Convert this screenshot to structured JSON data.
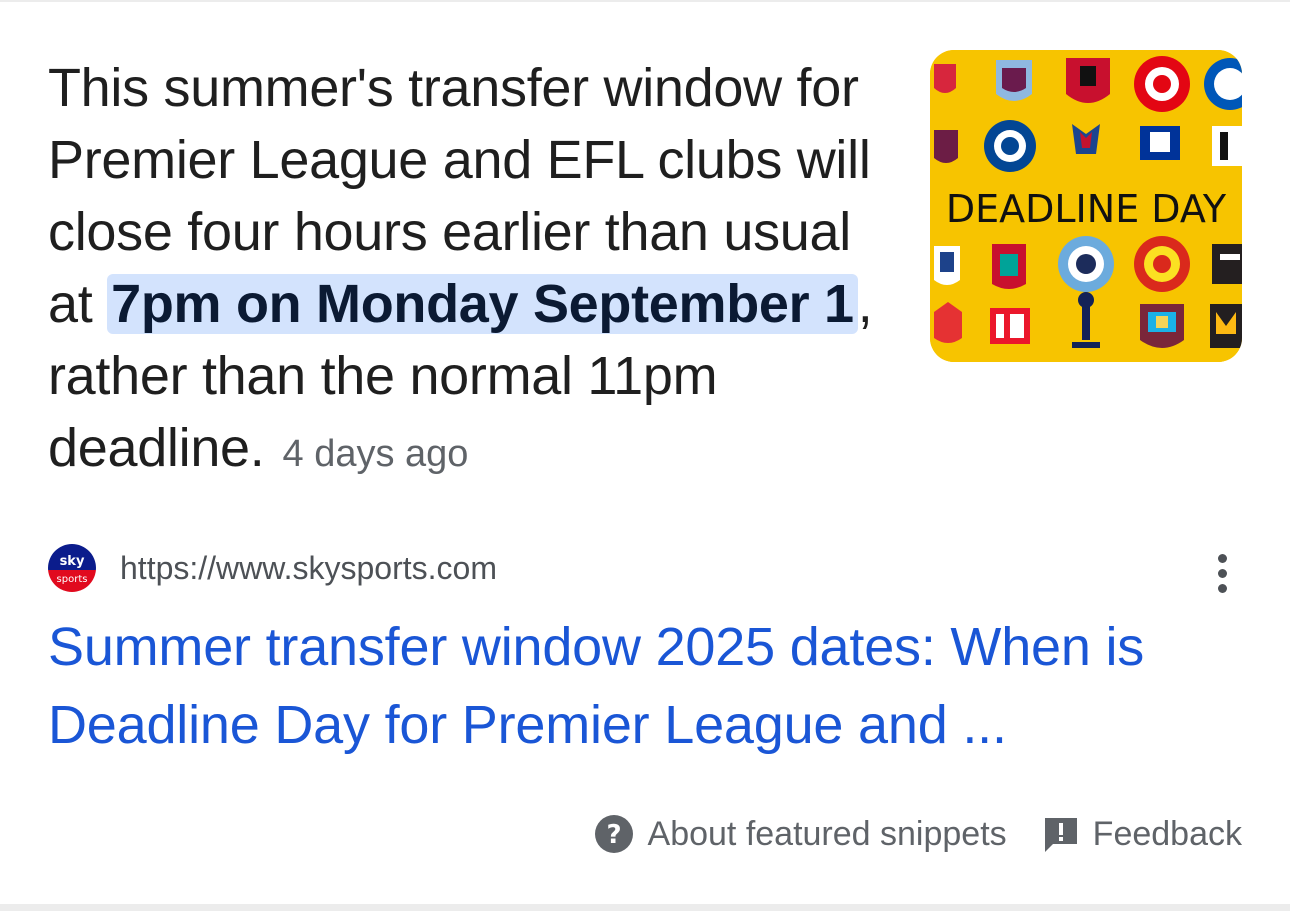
{
  "snippet": {
    "text_before": "This summer's transfer window for Premier League and EFL clubs will close four hours earlier than usual at ",
    "highlight": "7pm on Monday September 1",
    "text_after": ", rather than the normal 11pm deadline.",
    "age": "4 days ago"
  },
  "thumbnail": {
    "banner_text": "DEADLINE DAY",
    "background_color": "#f7c400",
    "favicon_text_top": "sky",
    "favicon_text_bottom": "sports"
  },
  "source": {
    "url": "https://www.skysports.com",
    "menu_icon": "more-vert-icon"
  },
  "result": {
    "title": "Summer transfer window 2025 dates: When is Deadline Day for Premier League and ..."
  },
  "footer": {
    "about_label": "About featured snippets",
    "about_icon": "help-circle-icon",
    "feedback_label": "Feedback",
    "feedback_icon": "feedback-icon"
  },
  "colors": {
    "highlight_bg": "#d3e3fd",
    "link": "#1a56d6",
    "muted": "#5f6368"
  }
}
